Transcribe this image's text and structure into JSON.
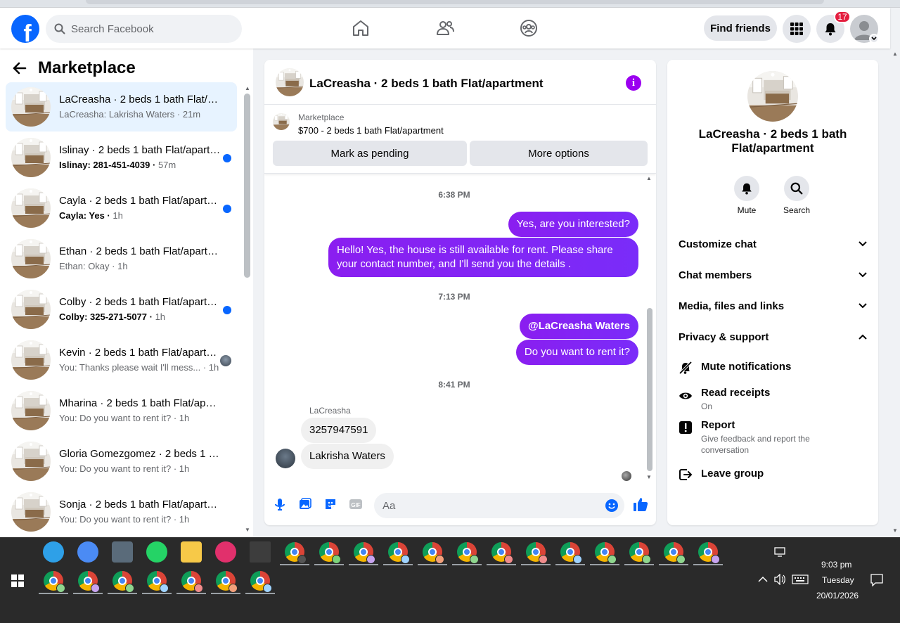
{
  "topnav": {
    "logo_letter": "f",
    "search_placeholder": "Search Facebook",
    "find_friends": "Find friends",
    "notification_count": "17"
  },
  "sidebar": {
    "title": "Marketplace",
    "conversations": [
      {
        "name": "LaCreasha · 2 beds 1 bath Flat/apartment",
        "preview": "LaCreasha: Lakrisha Waters",
        "time": "21m",
        "active": true,
        "unread": false
      },
      {
        "name": "Islinay · 2 beds 1 bath Flat/apartment",
        "preview": "Islinay: 281-451-4039",
        "time": "57m",
        "active": false,
        "unread": true
      },
      {
        "name": "Cayla · 2 beds 1 bath Flat/apartment",
        "preview": "Cayla: Yes",
        "time": "1h",
        "active": false,
        "unread": true
      },
      {
        "name": "Ethan · 2 beds 1 bath Flat/apartment",
        "preview": "Ethan: Okay",
        "time": "1h",
        "active": false,
        "unread": false
      },
      {
        "name": "Colby · 2 beds 1 bath Flat/apartment",
        "preview": "Colby: 325-271-5077",
        "time": "1h",
        "active": false,
        "unread": true
      },
      {
        "name": "Kevin · 2 beds 1 bath Flat/apartment",
        "preview": "You: Thanks please wait I'll mess...",
        "time": "1h",
        "active": false,
        "unread": false,
        "seen": true
      },
      {
        "name": "Mharina · 2 beds 1 bath Flat/apartment",
        "preview": "You: Do you want to rent it?",
        "time": "1h",
        "active": false,
        "unread": false
      },
      {
        "name": "Gloria Gomezgomez · 2 beds 1 bath Flat/apartment",
        "preview": "You: Do you want to rent it?",
        "time": "1h",
        "active": false,
        "unread": false
      },
      {
        "name": "Sonja · 2 beds 1 bath Flat/apartment",
        "preview": "You: Do you want to rent it?",
        "time": "1h",
        "active": false,
        "unread": false
      }
    ]
  },
  "chat": {
    "title": "LaCreasha · 2 beds 1 bath Flat/apartment",
    "marketplace_label": "Marketplace",
    "listing": "$700 - 2 beds 1 bath Flat/apartment",
    "mark_pending": "Mark as pending",
    "more_options": "More options",
    "timestamps": [
      "6:38 PM",
      "7:13 PM",
      "8:41 PM"
    ],
    "messages_out": [
      "Yes, are you interested?",
      "Hello! Yes, the house is still available for rent. Please share your contact number, and I'll send you the details .",
      "@LaCreasha Waters",
      "Do you want to rent it?"
    ],
    "sender_name": "LaCreasha",
    "messages_in": [
      "3257947591",
      "Lakrisha Waters"
    ],
    "composer_placeholder": "Aa"
  },
  "details": {
    "name": "LaCreasha · 2 beds 1 bath Flat/apartment",
    "mute_label": "Mute",
    "search_label": "Search",
    "sections": [
      "Customize chat",
      "Chat members",
      "Media, files and links",
      "Privacy & support"
    ],
    "privacy_items": {
      "mute_notifications": "Mute notifications",
      "read_receipts": "Read receipts",
      "read_receipts_value": "On",
      "report": "Report",
      "report_desc": "Give feedback and report the conversation",
      "leave_group": "Leave group"
    }
  },
  "taskbar": {
    "time": "9:03 pm",
    "day": "Tuesday",
    "date": "20/01/2026"
  },
  "colors": {
    "brand": "#0866ff",
    "bubble_out": "#7e23f8",
    "unread_dot": "#0866ff",
    "badge": "#e41e3f"
  }
}
